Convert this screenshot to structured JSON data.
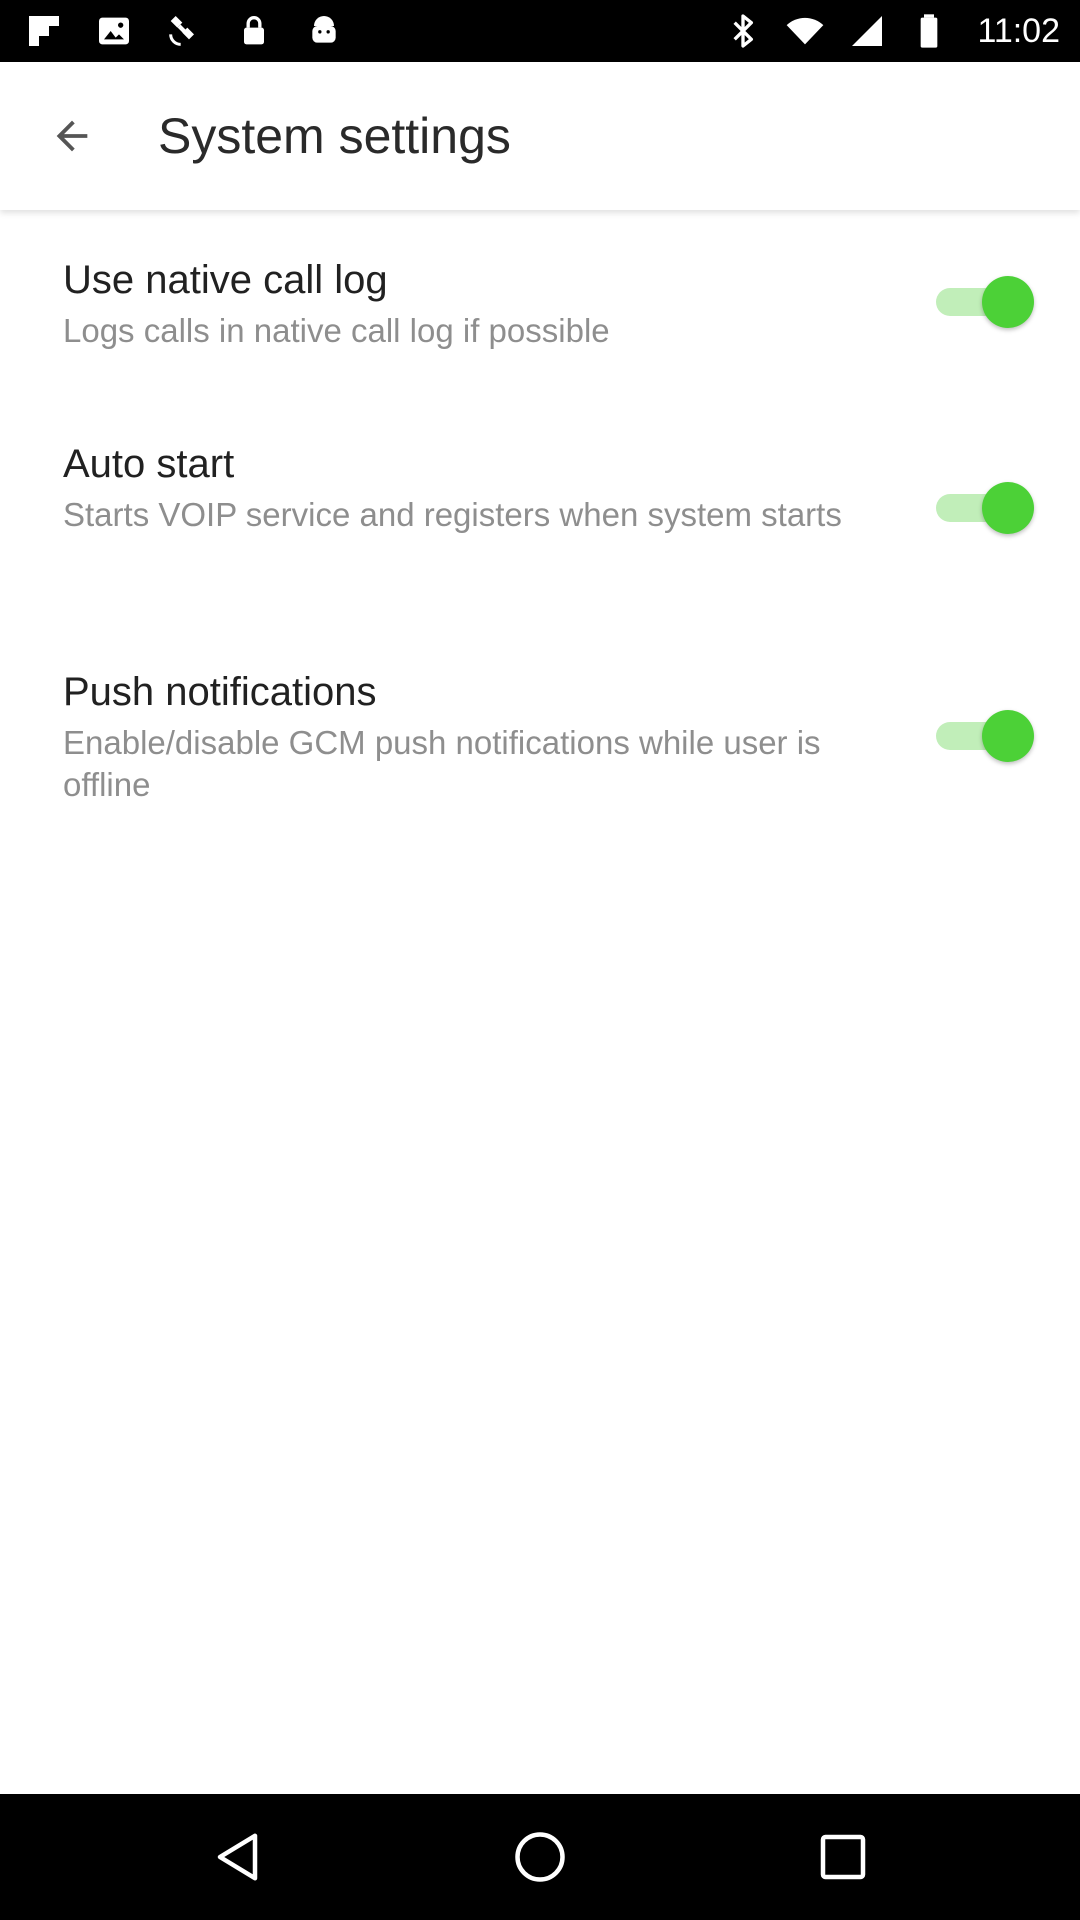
{
  "status_bar": {
    "time": "11:02",
    "left_icons": [
      "flipboard-icon",
      "image-icon",
      "satellite-fake-gps-icon",
      "lock-icon",
      "android-icon"
    ],
    "right_icons": [
      "bluetooth-icon",
      "wifi-icon",
      "cellular-signal-icon",
      "battery-icon"
    ]
  },
  "app_bar": {
    "back_icon": "arrow-back-icon",
    "title": "System settings"
  },
  "settings": [
    {
      "title": "Use native call log",
      "description": "Logs calls in native call log if possible",
      "enabled": true
    },
    {
      "title": "Auto start",
      "description": "Starts VOIP service and registers when system starts",
      "enabled": true
    },
    {
      "title": "Push notifications",
      "description": "Enable/disable GCM push notifications while user is offline",
      "enabled": true
    }
  ],
  "nav_bar": {
    "buttons": [
      "back-triangle-icon",
      "home-circle-icon",
      "recents-square-icon"
    ]
  },
  "colors": {
    "toggle_on": "#4CD137",
    "toggle_on_track": "#8EE07F",
    "status_bar": "#000000",
    "nav_bar": "#000000"
  }
}
